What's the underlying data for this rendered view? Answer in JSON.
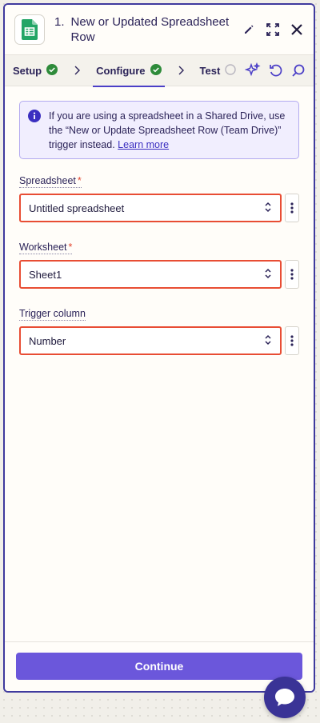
{
  "header": {
    "step_number": "1.",
    "title": "New or Updated Spreadsheet Row"
  },
  "tabs": [
    {
      "label": "Setup",
      "complete": true
    },
    {
      "label": "Configure",
      "complete": true,
      "active": true
    },
    {
      "label": "Test",
      "complete": false
    }
  ],
  "notice": {
    "text": "If you are using a spreadsheet in a Shared Drive, use the “New or Update Spreadsheet Row (Team Drive)” trigger instead.",
    "link": "Learn more"
  },
  "fields": [
    {
      "label": "Spreadsheet",
      "required": true,
      "value": "Untitled spreadsheet"
    },
    {
      "label": "Worksheet",
      "required": true,
      "value": "Sheet1"
    },
    {
      "label": "Trigger column",
      "required": false,
      "value": "Number"
    }
  ],
  "footer": {
    "continue_label": "Continue"
  },
  "colors": {
    "accent": "#6b57db",
    "success": "#2e8b3a",
    "error_outline": "#e84d34"
  }
}
